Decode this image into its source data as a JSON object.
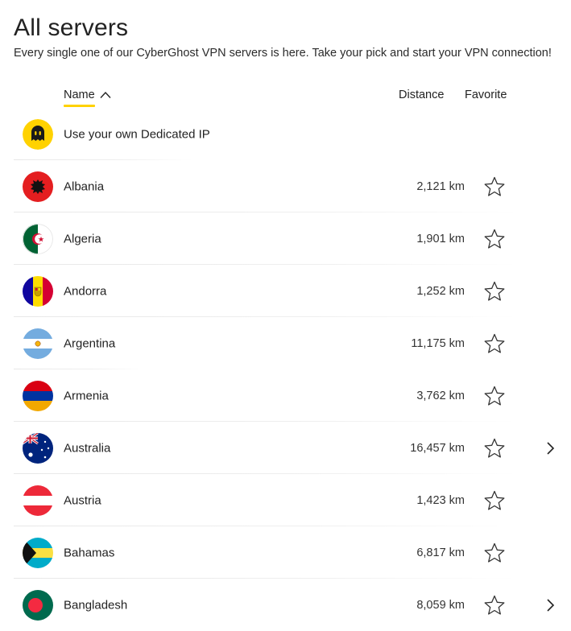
{
  "page": {
    "title": "All servers",
    "subtitle": "Every single one of our CyberGhost VPN servers is here. Take your pick and start your VPN connection!"
  },
  "columns": {
    "name": "Name",
    "distance": "Distance",
    "favorite": "Favorite",
    "sort": "ascending"
  },
  "dedicated": {
    "label": "Use your own Dedicated IP",
    "icon": "cyberghost-logo-icon",
    "icon_color": "#ffd200"
  },
  "servers": [
    {
      "name": "Albania",
      "distance": "2,121 km",
      "flag": "albania-flag-icon",
      "favorite": false,
      "has_children": false
    },
    {
      "name": "Algeria",
      "distance": "1,901 km",
      "flag": "algeria-flag-icon",
      "favorite": false,
      "has_children": false
    },
    {
      "name": "Andorra",
      "distance": "1,252 km",
      "flag": "andorra-flag-icon",
      "favorite": false,
      "has_children": false
    },
    {
      "name": "Argentina",
      "distance": "11,175 km",
      "flag": "argentina-flag-icon",
      "favorite": false,
      "has_children": false
    },
    {
      "name": "Armenia",
      "distance": "3,762 km",
      "flag": "armenia-flag-icon",
      "favorite": false,
      "has_children": false
    },
    {
      "name": "Australia",
      "distance": "16,457 km",
      "flag": "australia-flag-icon",
      "favorite": false,
      "has_children": true
    },
    {
      "name": "Austria",
      "distance": "1,423 km",
      "flag": "austria-flag-icon",
      "favorite": false,
      "has_children": false
    },
    {
      "name": "Bahamas",
      "distance": "6,817 km",
      "flag": "bahamas-flag-icon",
      "favorite": false,
      "has_children": false
    },
    {
      "name": "Bangladesh",
      "distance": "8,059 km",
      "flag": "bangladesh-flag-icon",
      "favorite": false,
      "has_children": true
    }
  ],
  "colors": {
    "accent": "#ffd200",
    "text": "#222222",
    "divider": "#e8e8e8"
  }
}
